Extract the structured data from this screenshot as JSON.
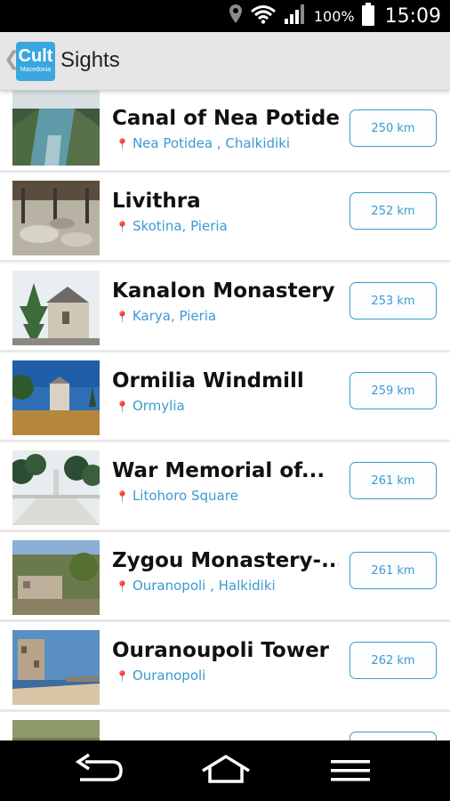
{
  "status": {
    "battery_percent": "100%",
    "time": "15:09",
    "icons": [
      "location-icon",
      "wifi-icon",
      "signal-icon",
      "battery-icon"
    ]
  },
  "actionbar": {
    "logo_text": "Cult",
    "logo_subtext": "Macedonia",
    "title": "Sights"
  },
  "sights": [
    {
      "name": "Canal of Nea Potidea",
      "location": "Nea Potidea , Chalkidiki",
      "distance": "250 km"
    },
    {
      "name": "Livithra",
      "location": "Skotina, Pieria",
      "distance": "252 km"
    },
    {
      "name": "Kanalon Monastery",
      "location": "Karya, Pieria",
      "distance": "253 km"
    },
    {
      "name": "Ormilia Windmill",
      "location": "Ormylia",
      "distance": "259 km"
    },
    {
      "name": "War Memorial of...",
      "location": "Litohoro Square",
      "distance": "261 km"
    },
    {
      "name": "Zygou Monastery-...",
      "location": "Ouranopoli , Halkidiki",
      "distance": "261 km"
    },
    {
      "name": "Ouranoupoli Tower",
      "location": "Ouranopoli",
      "distance": "262 km"
    }
  ],
  "colors": {
    "accent": "#3a9bd0",
    "logo": "#3aa6e0",
    "actionbar": "#e6e6e6"
  },
  "navbar": {
    "icons": [
      "back-icon",
      "home-icon",
      "menu-icon"
    ]
  }
}
